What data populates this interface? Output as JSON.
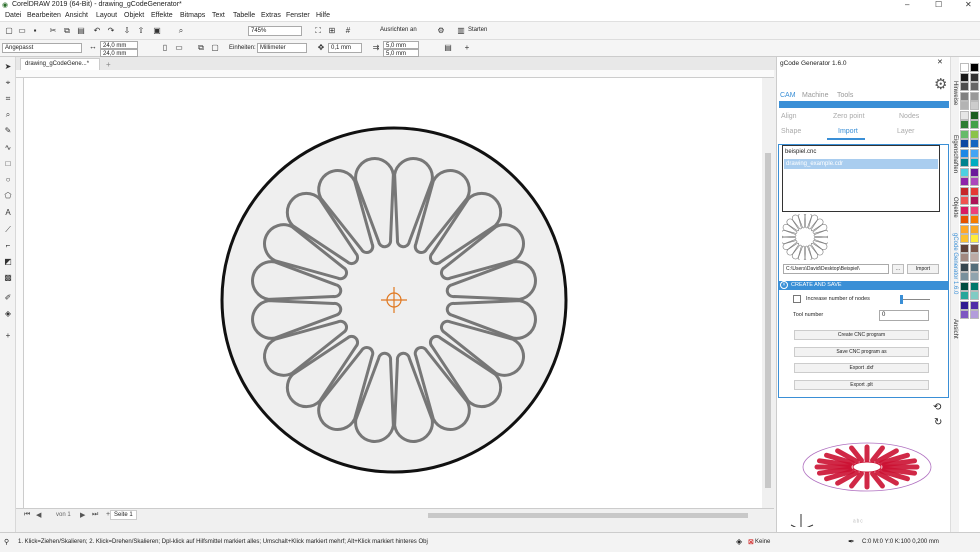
{
  "window": {
    "title": "CorelDRAW 2019 (64-Bit) - drawing_gCodeGenerator*",
    "controls": [
      "–",
      "☐",
      "✕"
    ]
  },
  "menu": [
    "Datei",
    "Bearbeiten",
    "Ansicht",
    "Layout",
    "Objekt",
    "Effekte",
    "Bitmaps",
    "Text",
    "Tabelle",
    "Extras",
    "Fenster",
    "Hilfe"
  ],
  "toolbar1": {
    "zoom": "745%",
    "snap_label": "Ausrichten an",
    "start_label": "Starten"
  },
  "toolbar2": {
    "preset": "Angepasst",
    "width": "24,0 mm",
    "height": "24,0 mm",
    "units_label": "Einheiten:",
    "units_value": "Millimeter",
    "nudge": "0,1 mm",
    "dup_x": "5,0 mm",
    "dup_y": "5,0 mm"
  },
  "document_tab": "drawing_gCodeGene...*",
  "page": {
    "counter": "von 1",
    "page_tab": "Seite 1"
  },
  "status": {
    "hint": "1. Klick=Ziehen/Skalieren; 2. Klick=Drehen/Skalieren; Dpl-klick auf Hilfsmittel markiert alles; Umschalt+Klick markiert mehrf; Alt+Klick markiert hinteres Obj",
    "fill": "Keine",
    "outline": "C:0 M:0 Y:0 K:100  0,200 mm"
  },
  "docker": {
    "title": "gCode Generator 1.6.0",
    "tabs": [
      "CAM",
      "Machine",
      "Tools"
    ],
    "subtabs_row1": [
      "Align",
      "Zero point",
      "Nodes"
    ],
    "subtabs_row2": [
      "Shape",
      "Import",
      "Layer"
    ],
    "files": [
      "beispiel.cnc",
      "drawing_example.cdr"
    ],
    "path": "C:\\Users\\David\\Desktop\\Beispiel\\",
    "browse_label": "...",
    "import_label": "Import",
    "section_create": "CREATE AND SAVE",
    "increase_nodes_label": "Increase number of nodes",
    "tool_number_label": "Tool number",
    "tool_number_value": "0",
    "buttons": [
      "Create CNC program",
      "Save CNC program as",
      "Export .dxf",
      "Export .plt"
    ]
  },
  "right_tabs": [
    "Hinweise",
    "Eigenschaften",
    "Objekte",
    "gCode Generator 1.6.0",
    "Ansicht"
  ],
  "colors": {
    "accent": "#3a8fd6",
    "petal_stroke": "#777777",
    "petal_fill": "#eeeeee",
    "center_mark": "#e07820",
    "preview_red": "#cc1133"
  }
}
